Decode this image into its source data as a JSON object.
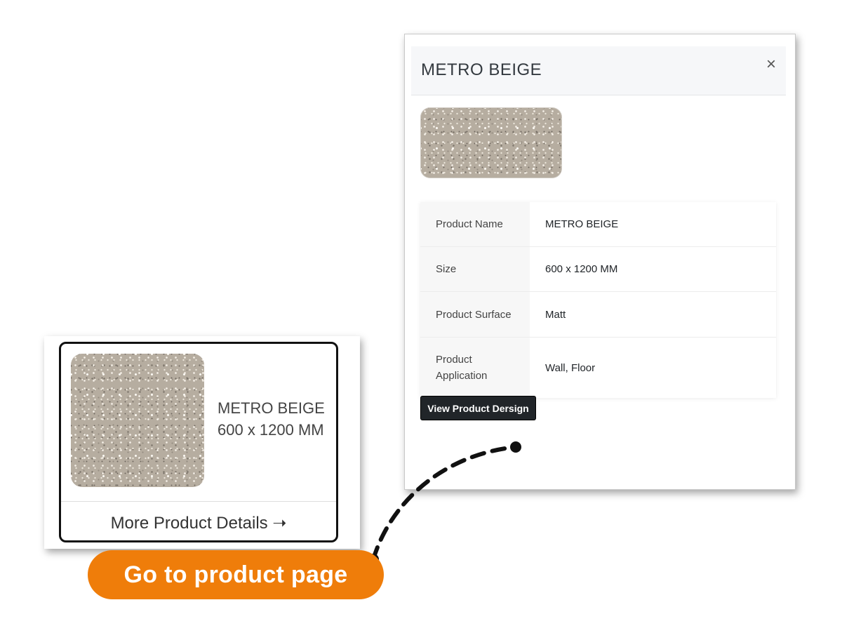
{
  "modal": {
    "title": "METRO BEIGE",
    "close_symbol": "×",
    "specs": [
      {
        "label": "Product Name",
        "value": "METRO BEIGE"
      },
      {
        "label": "Size",
        "value": "600 x 1200 MM"
      },
      {
        "label": "Product Surface",
        "value": "Matt"
      },
      {
        "label": "Product Application",
        "value": "Wall, Floor"
      }
    ],
    "button_label": "View Product Dersign"
  },
  "card": {
    "name": "METRO BEIGE",
    "size": "600 x 1200 MM",
    "link_label": "More Product Details ➝"
  },
  "callout": {
    "label": "Go to product page",
    "color": "#ef7d0a"
  }
}
